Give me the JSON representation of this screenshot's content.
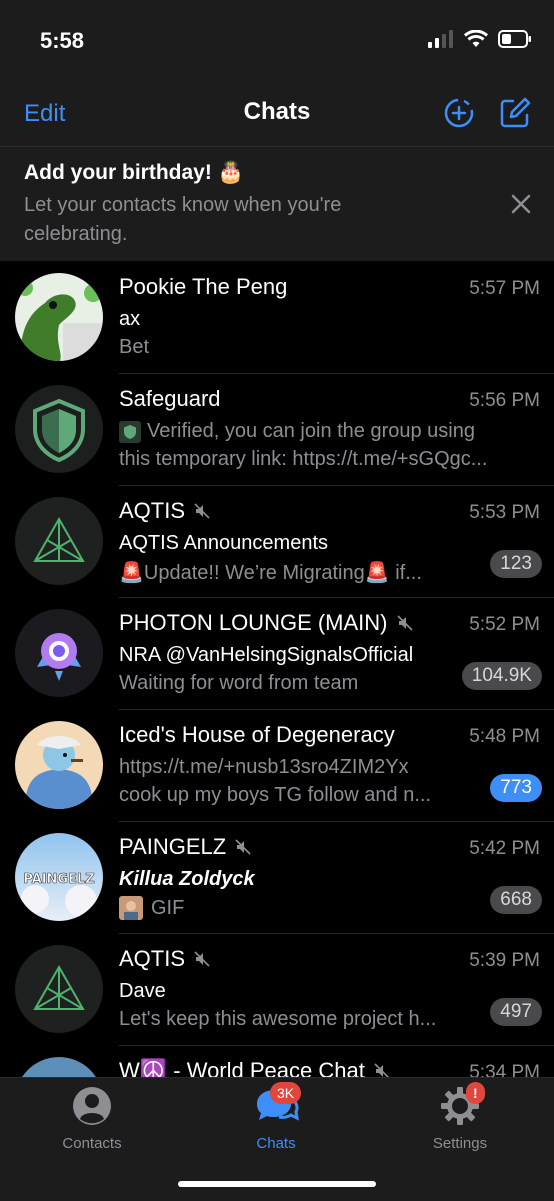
{
  "status": {
    "time": "5:58"
  },
  "nav": {
    "edit": "Edit",
    "title": "Chats"
  },
  "banner": {
    "title": "Add your birthday! 🎂",
    "subtitle": "Let your contacts know when you're celebrating."
  },
  "chats": [
    {
      "name": "Pookie The Peng",
      "time": "5:57 PM",
      "line2": "ax",
      "line3": "Bet",
      "muted": false,
      "badge": ""
    },
    {
      "name": "Safeguard",
      "time": "5:56 PM",
      "line2": "Verified, you can join the group using",
      "line3": "this temporary link: https://t.me/+sGQgc...",
      "muted": false,
      "badge": ""
    },
    {
      "name": "AQTIS",
      "time": "5:53 PM",
      "line2": "AQTIS Announcements",
      "line3": "🚨Update!! We’re Migrating🚨 if...",
      "muted": true,
      "badge": "123"
    },
    {
      "name": "PHOTON LOUNGE (MAIN)",
      "time": "5:52 PM",
      "line2": "NRA @VanHelsingSignalsOfficial",
      "line3": "Waiting for word from team",
      "muted": true,
      "badge": "104.9K"
    },
    {
      "name": "Iced's House of Degeneracy",
      "time": "5:48 PM",
      "line2": "https://t.me/+nusb13sro4ZIM2Yx",
      "line3": "cook up my boys TG follow and n...",
      "muted": false,
      "badge": "773"
    },
    {
      "name": "PAINGELZ",
      "time": "5:42 PM",
      "line2": "Killua Zoldyck",
      "line3": "GIF",
      "muted": true,
      "badge": "668",
      "avatar_text": "PAINGELZ"
    },
    {
      "name": "AQTIS",
      "time": "5:39 PM",
      "line2": "Dave",
      "line3": "Let's keep this awesome project h...",
      "muted": true,
      "badge": "497"
    },
    {
      "name": "W☮️ - World Peace Chat",
      "time": "5:34 PM",
      "line2": "",
      "line3": "",
      "muted": true,
      "badge": ""
    }
  ],
  "tabbar": {
    "contacts": "Contacts",
    "chats": "Chats",
    "chats_badge": "3K",
    "settings": "Settings",
    "settings_badge": "!"
  },
  "colors": {
    "accent": "#3e8ef7",
    "badge_red": "#e0463b",
    "background": "#000000",
    "bar": "#1c1c1d"
  }
}
